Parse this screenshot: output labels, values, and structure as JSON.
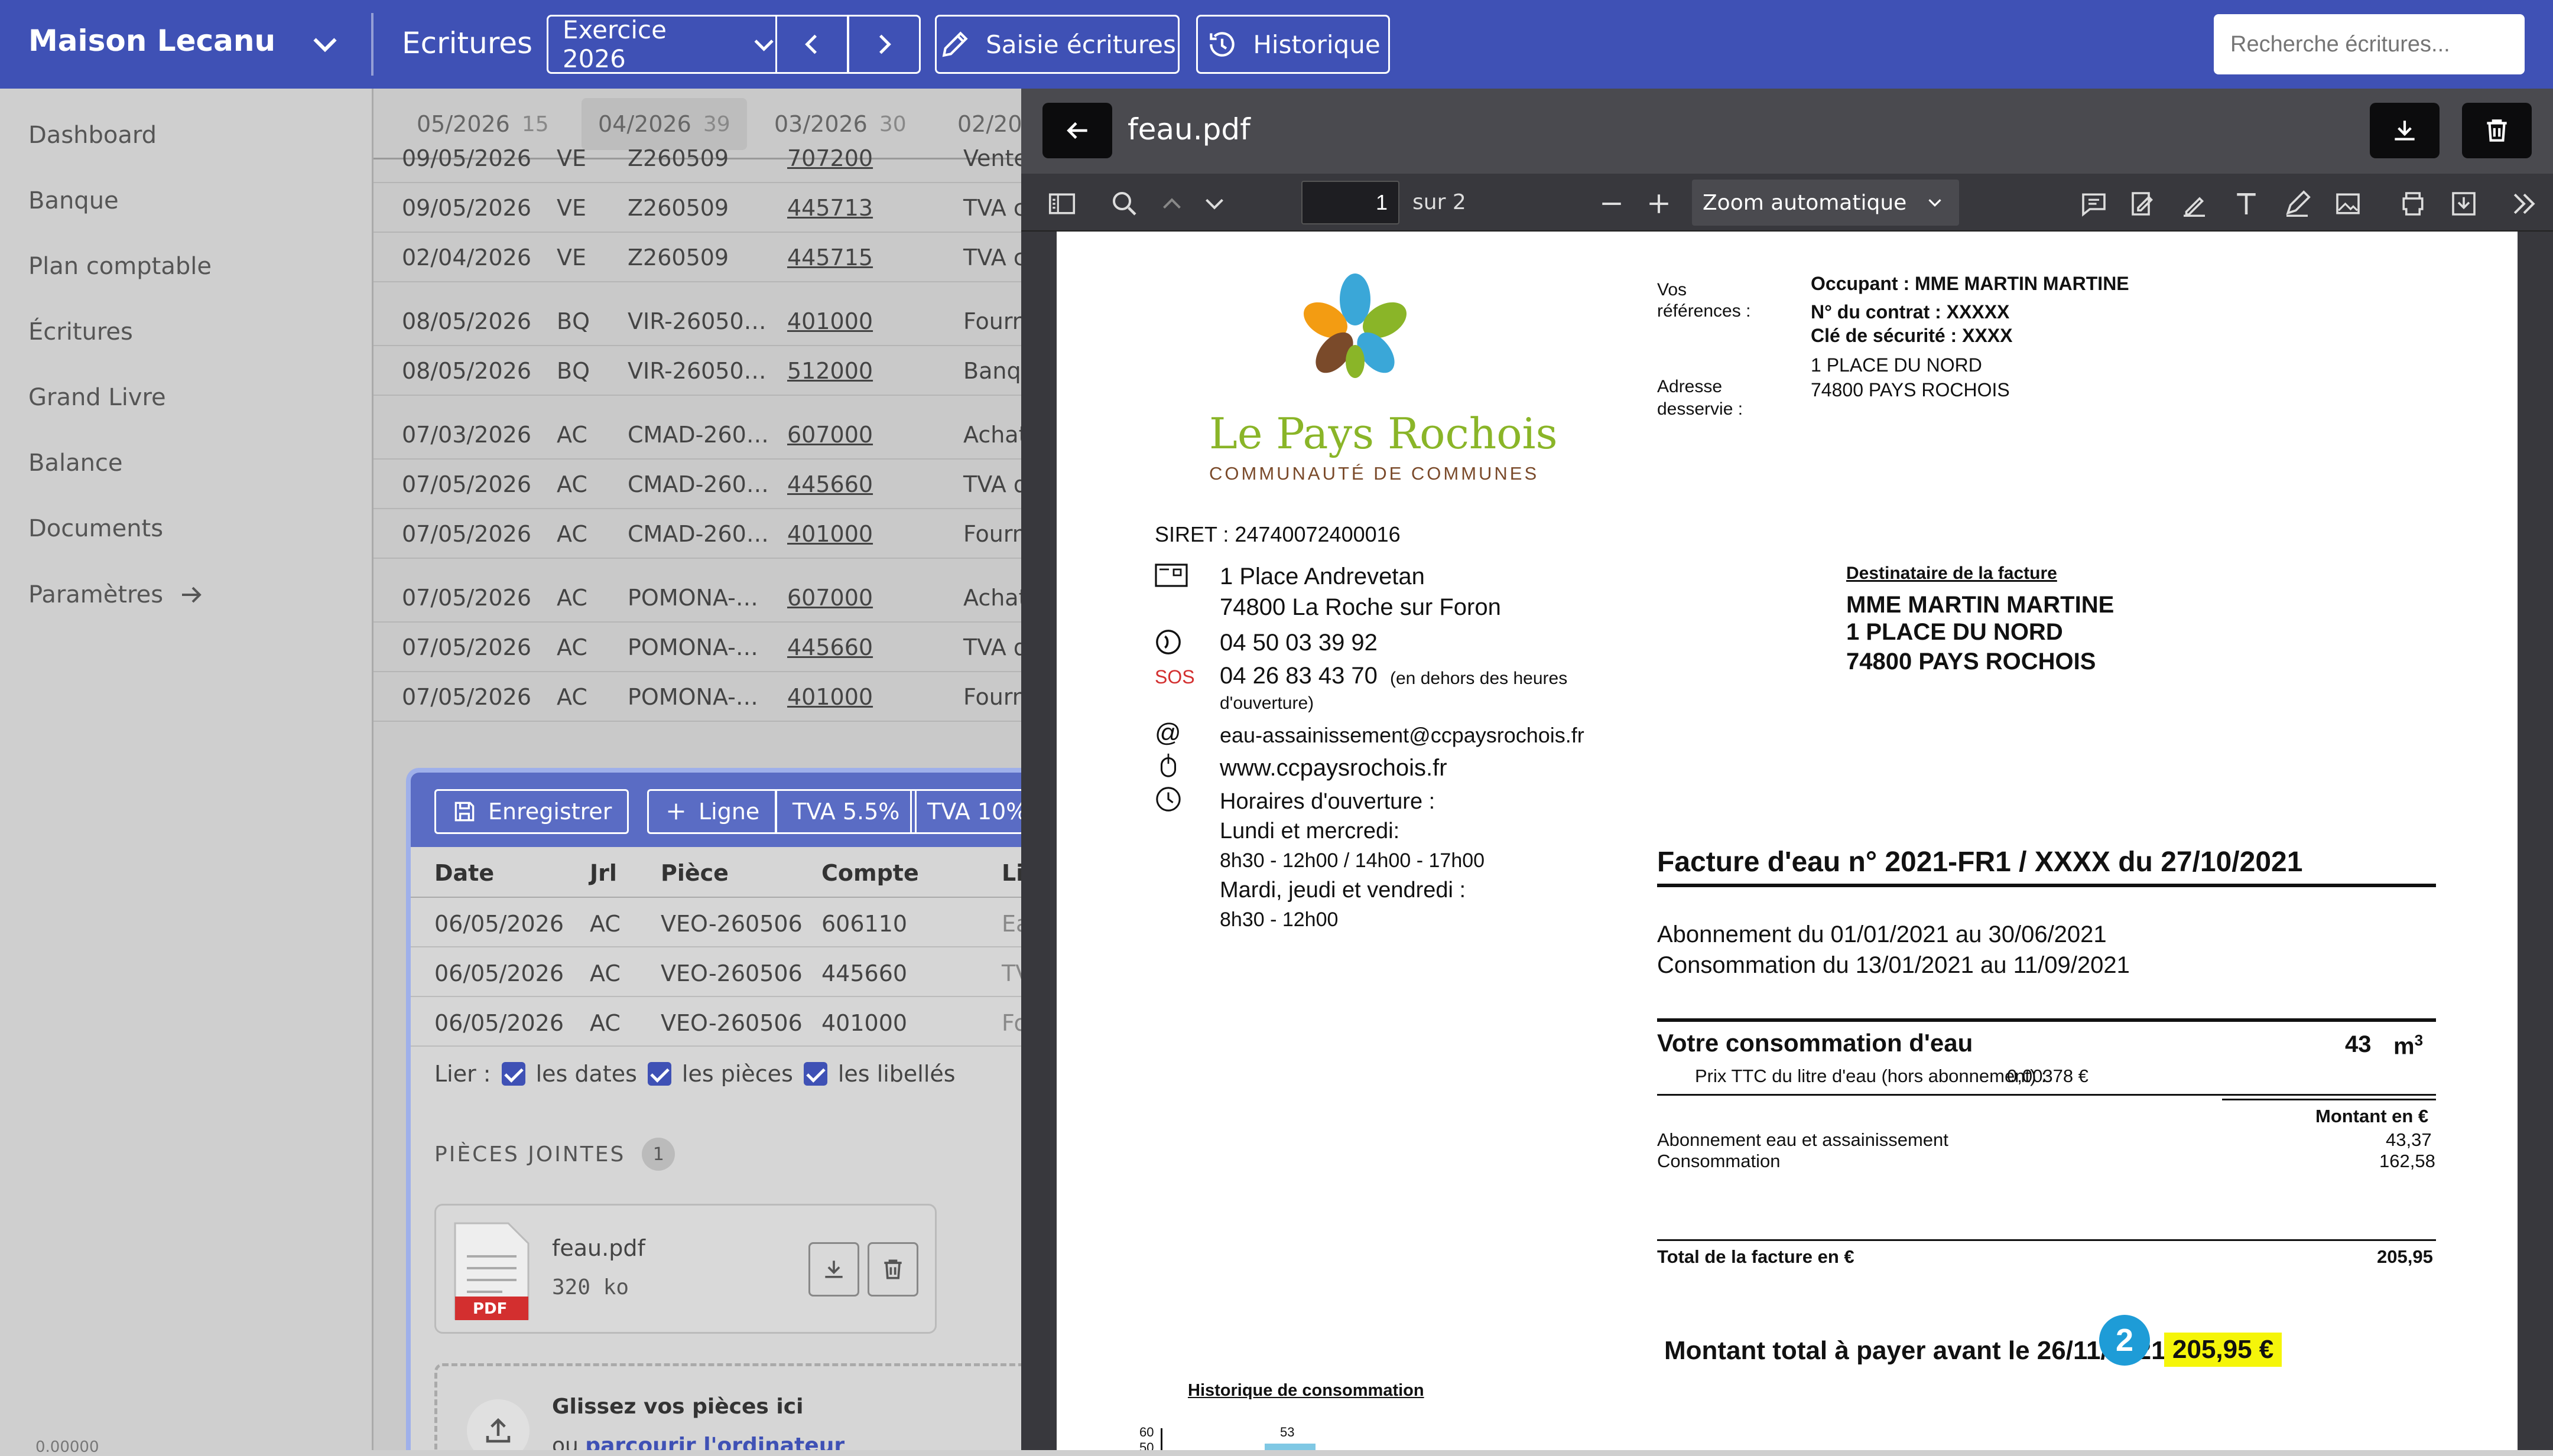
{
  "header": {
    "company": "Maison Lecanu",
    "section": "Ecritures",
    "exercise": "Exercice 2026",
    "entry_btn": "Saisie écritures",
    "history_btn": "Historique",
    "search_placeholder": "Recherche écritures..."
  },
  "sidebar": {
    "items": [
      "Dashboard",
      "Banque",
      "Plan comptable",
      "Écritures",
      "Grand Livre",
      "Balance",
      "Documents",
      "Paramètres"
    ],
    "footer": "0.00000"
  },
  "months": [
    {
      "label": "05/2026",
      "count": "15"
    },
    {
      "label": "04/2026",
      "count": "39"
    },
    {
      "label": "03/2026",
      "count": "30"
    },
    {
      "label": "02/20",
      "count": ""
    }
  ],
  "entries": [
    {
      "date": "09/05/2026",
      "jrl": "VE",
      "piece": "Z260509",
      "account": "707200",
      "label": "Vente"
    },
    {
      "date": "09/05/2026",
      "jrl": "VE",
      "piece": "Z260509",
      "account": "445713",
      "label": "TVA c"
    },
    {
      "date": "02/04/2026",
      "jrl": "VE",
      "piece": "Z260509",
      "account": "445715",
      "label": "TVA c"
    },
    {
      "date": "08/05/2026",
      "jrl": "BQ",
      "piece": "VIR-26050…",
      "account": "401000",
      "label": "Fourn"
    },
    {
      "date": "08/05/2026",
      "jrl": "BQ",
      "piece": "VIR-26050…",
      "account": "512000",
      "label": "Banq"
    },
    {
      "date": "07/03/2026",
      "jrl": "AC",
      "piece": "CMAD-260…",
      "account": "607000",
      "label": "Achat"
    },
    {
      "date": "07/05/2026",
      "jrl": "AC",
      "piece": "CMAD-260…",
      "account": "445660",
      "label": "TVA d"
    },
    {
      "date": "07/05/2026",
      "jrl": "AC",
      "piece": "CMAD-260…",
      "account": "401000",
      "label": "Fourn"
    },
    {
      "date": "07/05/2026",
      "jrl": "AC",
      "piece": "POMONA-…",
      "account": "607000",
      "label": "Achat"
    },
    {
      "date": "07/05/2026",
      "jrl": "AC",
      "piece": "POMONA-…",
      "account": "445660",
      "label": "TVA d"
    },
    {
      "date": "07/05/2026",
      "jrl": "AC",
      "piece": "POMONA-…",
      "account": "401000",
      "label": "Fourn"
    }
  ],
  "form": {
    "save": "Enregistrer",
    "add_line": "Ligne",
    "vat1": "TVA 5.5%",
    "vat2": "TVA 10%",
    "columns": [
      "Date",
      "Jrl",
      "Pièce",
      "Compte",
      "Li"
    ],
    "rows": [
      {
        "date": "06/05/2026",
        "jrl": "AC",
        "piece": "VEO-260506",
        "account": "606110",
        "label": "Ea"
      },
      {
        "date": "06/05/2026",
        "jrl": "AC",
        "piece": "VEO-260506",
        "account": "445660",
        "label": "TV"
      },
      {
        "date": "06/05/2026",
        "jrl": "AC",
        "piece": "VEO-260506",
        "account": "401000",
        "label": "Fo"
      }
    ],
    "link_label": "Lier :",
    "link_dates": "les dates",
    "link_pieces": "les pièces",
    "link_labels": "les libellés",
    "attachments_title": "PIÈCES JOINTES",
    "attachments_count": "1",
    "file_name": "feau.pdf",
    "file_size": "320 ko",
    "file_badge": "PDF",
    "drop_title": "Glissez vos pièces ici",
    "drop_or": "ou",
    "drop_link": "parcourir l'ordinateur"
  },
  "viewer": {
    "filename": "feau.pdf",
    "page": "1",
    "page_total": "sur 2",
    "zoom": "Zoom automatique"
  },
  "invoice": {
    "logo_name": "Le Pays Rochois",
    "logo_sub": "COMMUNAUTÉ DE COMMUNES",
    "refs_label1": "Vos",
    "refs_label2": "références :",
    "occupant": "Occupant : MME MARTIN MARTINE",
    "contract": "N° du contrat : XXXXX",
    "key": "Clé de sécurité : XXXX",
    "addr1": "1 PLACE DU NORD",
    "addr2": "74800 PAYS ROCHOIS",
    "served1": "Adresse",
    "served2": "desservie :",
    "siret": "SIRET : 24740072400016",
    "org_addr1": "1 Place Andrevetan",
    "org_addr2": "74800 La Roche sur Foron",
    "phone": "04 50 03 39 92",
    "sos_label": "SOS",
    "sos_phone": "04 26 83 43 70",
    "sos_note1": "(en dehors des heures",
    "sos_note2": "d'ouverture)",
    "email": "eau-assainissement@ccpaysrochois.fr",
    "web": "www.ccpaysrochois.fr",
    "hours_title": "Horaires d'ouverture :",
    "hours1": "Lundi et mercredi:",
    "hours2": "8h30 - 12h00 / 14h00 - 17h00",
    "hours3": "Mardi, jeudi et vendredi :",
    "hours4": "8h30 - 12h00",
    "recipient_label": "Destinataire de la facture",
    "recipient1": "MME  MARTIN  MARTINE",
    "recipient2": "1 PLACE DU NORD",
    "recipient3": "74800 PAYS ROCHOIS",
    "title": "Facture d'eau n° 2021-FR1 / XXXX du 27/10/2021",
    "sub_period": "Abonnement du 01/01/2021 au 30/06/2021",
    "cons_period": "Consommation du 13/01/2021 au 11/09/2021",
    "cons_title": "Votre consommation d'eau",
    "cons_value": "43",
    "cons_unit": "m",
    "cons_exp": "3",
    "price_label": "Prix TTC du litre d'eau (hors abonnement) :",
    "price_value": "0,00378 €",
    "amount_header": "Montant en €",
    "line1_label": "Abonnement eau et assainissement",
    "line1_value": "43,37",
    "line2_label": "Consommation",
    "line2_value": "162,58",
    "total_label": "Total de la facture en €",
    "total_value": "205,95",
    "due_label": "Montant total à payer avant le 26/11/2021",
    "due_value": "205,95 €",
    "marker": "2",
    "history_title": "Historique de consommation",
    "hist_y1": "60",
    "hist_y2": "50",
    "hist_bar": "53"
  },
  "colors": {
    "primary": "#3f51b5",
    "highlight": "#f5f50a",
    "marker": "#1e9cd7",
    "logo_green": "#8ab528",
    "logo_blue": "#3aa7d8",
    "logo_brown": "#7a4a2a"
  }
}
